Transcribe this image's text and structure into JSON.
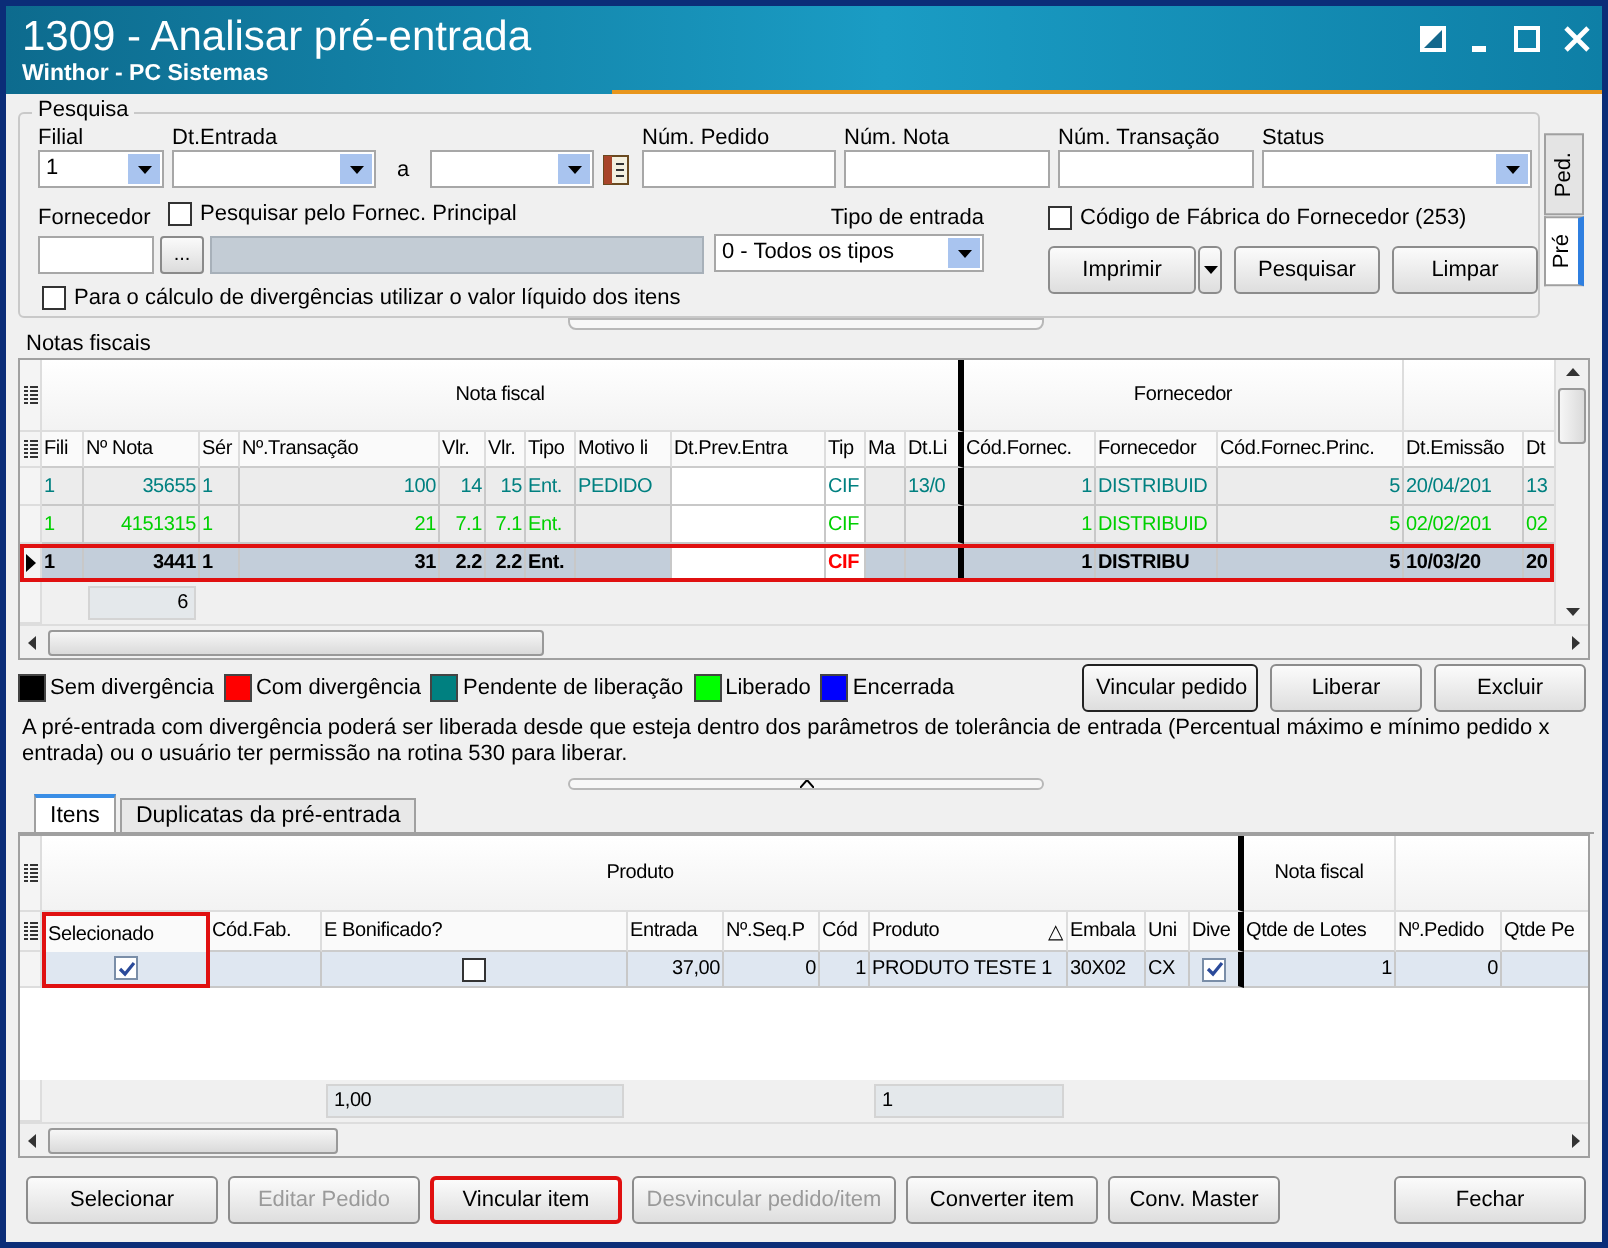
{
  "window": {
    "title": "1309 - Analisar pré-entrada",
    "subtitle": "Winthor - PC Sistemas"
  },
  "search": {
    "title": "Pesquisa",
    "filial": {
      "label": "Filial",
      "value": "1"
    },
    "dt_entrada": {
      "label": "Dt.Entrada"
    },
    "range_label": "a",
    "num_pedido": {
      "label": "Núm. Pedido"
    },
    "num_nota": {
      "label": "Núm. Nota"
    },
    "num_transacao": {
      "label": "Núm. Transação"
    },
    "status": {
      "label": "Status"
    },
    "fornecedor": {
      "label": "Fornecedor",
      "button": "..."
    },
    "principal": {
      "label": "Pesquisar pelo Fornec. Principal",
      "checked": false
    },
    "tipo_entrada": {
      "label": "Tipo de entrada",
      "value": "0 - Todos os tipos"
    },
    "fabrica": {
      "label": "Código de Fábrica do Fornecedor (253)",
      "checked": false
    },
    "liquido": {
      "label": "Para o cálculo de divergências utilizar o valor líquido dos itens",
      "checked": false
    },
    "buttons": [
      {
        "label": "Imprimir",
        "kind": "split"
      },
      {
        "label": "Pesquisar",
        "kind": "plain"
      },
      {
        "label": "Limpar",
        "kind": "plain"
      }
    ]
  },
  "side_tabs": [
    {
      "label": "Ped.",
      "selected": false
    },
    {
      "label": "Pré",
      "selected": true
    }
  ],
  "notas": {
    "title": "Notas fiscais",
    "groups": [
      "Nota fiscal",
      "Fornecedor"
    ],
    "columns": [
      {
        "label": "Fili"
      },
      {
        "label": "Nº Nota",
        "total": "6"
      },
      {
        "label": "Sér"
      },
      {
        "label": "Nº.Transação"
      },
      {
        "label": "Vlr."
      },
      {
        "label": "Vlr."
      },
      {
        "label": "Tipo"
      },
      {
        "label": "Motivo li"
      },
      {
        "label": "Dt.Prev.Entra"
      },
      {
        "label": "Tip"
      },
      {
        "label": "Ma"
      },
      {
        "label": "Dt.Li"
      },
      {
        "label": "Cód.Fornec."
      },
      {
        "label": "Fornecedor"
      },
      {
        "label": "Cód.Fornec.Princ."
      },
      {
        "label": "Dt.Emissão"
      },
      {
        "label": "Dt"
      }
    ],
    "rows": [
      {
        "color": "#008080",
        "selected": false,
        "highlighted": false,
        "cells": [
          "1",
          "35655",
          "1",
          "100",
          "14",
          "15",
          "Ent.",
          "PEDIDO",
          "",
          "CIF",
          "",
          "13/0",
          "1",
          "DISTRIBUID",
          "5",
          "20/04/201",
          "13"
        ]
      },
      {
        "color": "#00d000",
        "selected": false,
        "highlighted": false,
        "cells": [
          "1",
          "4151315",
          "1",
          "21",
          "7.1",
          "7.1",
          "Ent.",
          "",
          "",
          "CIF",
          "",
          "",
          "1",
          "DISTRIBUID",
          "5",
          "02/02/201",
          "02"
        ]
      },
      {
        "color": "#000000",
        "selected": true,
        "highlighted": true,
        "cells": [
          "1",
          "3441",
          "1",
          "31",
          "2.2",
          "2.2",
          "Ent.",
          "",
          "",
          {
            "kind": "text",
            "text": "CIF",
            "color": "#ff0000"
          },
          "",
          "",
          "1",
          "DISTRIBU",
          "5",
          "10/03/20",
          "20"
        ]
      }
    ]
  },
  "legend": [
    {
      "label": "Sem divergência",
      "color": "#000000"
    },
    {
      "label": "Com divergência",
      "color": "#ff0000"
    },
    {
      "label": "Pendente de liberação",
      "color": "#008080"
    },
    {
      "label": "Liberado",
      "color": "#00ff00"
    },
    {
      "label": "Encerrada",
      "color": "#0000ff"
    }
  ],
  "actions": [
    {
      "label": "Vincular pedido",
      "focused": true
    },
    {
      "label": "Liberar",
      "focused": false
    },
    {
      "label": "Excluir",
      "focused": false
    }
  ],
  "notice": "A pré-entrada com divergência poderá ser liberada desde que esteja dentro dos parâmetros de tolerância de entrada (Percentual máximo e mínimo pedido x entrada) ou o usuário ter permissão na rotina 530 para liberar.",
  "tabs": [
    {
      "label": "Itens",
      "selected": true
    },
    {
      "label": "Duplicatas da pré-entrada",
      "selected": false
    }
  ],
  "itens": {
    "groups": [
      "Produto",
      "Nota fiscal"
    ],
    "columns": [
      {
        "label": "Selecionado",
        "highlighted": true
      },
      {
        "label": "Cód.Fab.",
        "highlighted": false
      },
      {
        "label": "E Bonificado?",
        "highlighted": false,
        "total": "1,00"
      },
      {
        "label": "Entrada",
        "highlighted": false
      },
      {
        "label": "Nº.Seq.P",
        "highlighted": false
      },
      {
        "label": "Cód",
        "highlighted": false
      },
      {
        "label": "Produto",
        "highlighted": false,
        "sort_mark": "△",
        "total": "1"
      },
      {
        "label": "Embala",
        "highlighted": false
      },
      {
        "label": "Uni",
        "highlighted": false
      },
      {
        "label": "Dive",
        "highlighted": false
      },
      {
        "label": "Qtde de Lotes",
        "highlighted": false
      },
      {
        "label": "Nº.Pedido",
        "highlighted": false
      },
      {
        "label": "Qtde Pe",
        "highlighted": false
      }
    ],
    "rows": [
      {
        "color": "#000000",
        "selected": false,
        "highlighted": false,
        "cells": [
          {
            "kind": "check",
            "checked": true
          },
          "",
          {
            "kind": "check",
            "checked": false
          },
          "37,00",
          "0",
          "1",
          "PRODUTO TESTE 1",
          "30X02",
          "CX",
          {
            "kind": "check",
            "checked": true
          },
          "1",
          "0",
          ""
        ]
      }
    ]
  },
  "buttons": [
    {
      "label": "Selecionar",
      "disabled": false,
      "highlighted": false
    },
    {
      "label": "Editar Pedido",
      "disabled": true,
      "highlighted": false
    },
    {
      "label": "Vincular item",
      "disabled": false,
      "highlighted": true
    },
    {
      "label": "Desvincular pedido/item",
      "disabled": true,
      "highlighted": false
    },
    {
      "label": "Converter item",
      "disabled": false,
      "highlighted": false
    },
    {
      "label": "Conv. Master",
      "disabled": false,
      "highlighted": false
    },
    {
      "label": "Fechar",
      "disabled": false,
      "highlighted": false
    }
  ]
}
